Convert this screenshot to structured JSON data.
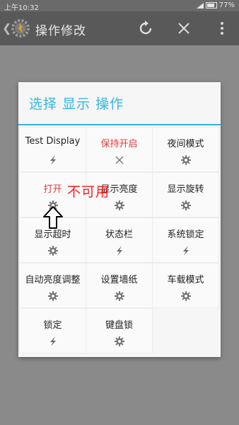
{
  "statusbar": {
    "time": "上午10:32",
    "battery": "77%"
  },
  "actionbar": {
    "title": "操作修改",
    "icons": [
      "back-chevron-icon",
      "tasker-logo-icon",
      "refresh-icon",
      "close-icon",
      "more-vert-icon"
    ]
  },
  "dialog": {
    "title": "选择 显示 操作",
    "items": [
      {
        "label": "Test Display",
        "icon": "bolt-icon",
        "highlight": false
      },
      {
        "label": "保持开启",
        "icon": "x-icon",
        "highlight": true
      },
      {
        "label": "夜间模式",
        "icon": "gear-icon",
        "highlight": false
      },
      {
        "label": "打开",
        "icon": "gear-icon",
        "highlight": true
      },
      {
        "label": "显示亮度",
        "icon": "gear-icon",
        "highlight": false
      },
      {
        "label": "显示旋转",
        "icon": "gear-icon",
        "highlight": false
      },
      {
        "label": "显示超时",
        "icon": "gear-icon",
        "highlight": false
      },
      {
        "label": "状态栏",
        "icon": "bolt-icon",
        "highlight": false
      },
      {
        "label": "系统锁定",
        "icon": "bolt-icon",
        "highlight": false
      },
      {
        "label": "自动亮度调整",
        "icon": "gear-icon",
        "highlight": false
      },
      {
        "label": "设置墙纸",
        "icon": "gear-icon",
        "highlight": false
      },
      {
        "label": "车载模式",
        "icon": "gear-icon",
        "highlight": false
      },
      {
        "label": "锁定",
        "icon": "bolt-icon",
        "highlight": false
      },
      {
        "label": "键盘锁",
        "icon": "gear-icon",
        "highlight": false
      }
    ]
  },
  "overlay": {
    "text": "不可用"
  },
  "colors": {
    "accent": "#33b5e5",
    "highlight": "#e53935",
    "overlay_text": "#ff1a1a"
  }
}
